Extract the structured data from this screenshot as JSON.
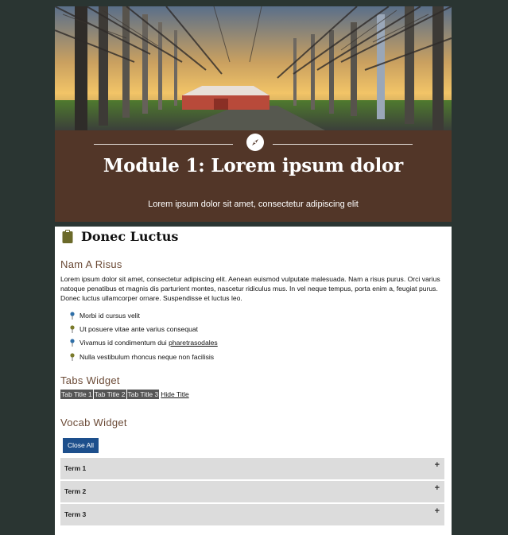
{
  "header": {
    "title": "Module 1: Lorem ipsum dolor",
    "subtitle": "Lorem ipsum dolor sit amet, consectetur adipiscing elit"
  },
  "section": {
    "title": "Donec Luctus"
  },
  "nam": {
    "heading": "Nam A Risus",
    "paragraph": "Lorem ipsum dolor sit amet, consectetur adipiscing elit. Aenean euismod vulputate malesuada. Nam a risus purus. Orci varius natoque penatibus et magnis dis parturient montes, nascetur ridiculus mus. In vel neque tempus, porta enim a, feugiat purus. Donec luctus ullamcorper ornare. Suspendisse et luctus leo.",
    "bullets": [
      {
        "text": "Morbi id cursus velit"
      },
      {
        "text": "Ut posuere vitae ante varius consequat"
      },
      {
        "text": "Vivamus id condimentum dui ",
        "link": "pharetrasodales"
      },
      {
        "text": "Nulla vestibulum rhoncus neque non facilisis"
      }
    ]
  },
  "tabs_widget": {
    "heading": "Tabs Widget",
    "tabs": [
      "Tab Title 1",
      "Tab Title 2",
      "Tab Title 3"
    ],
    "hide_label": "Hide Title"
  },
  "vocab_widget": {
    "heading": "Vocab Widget",
    "close_all": "Close All",
    "terms": [
      "Term 1",
      "Term 2",
      "Term 3"
    ],
    "expand_symbol": "+"
  },
  "colors": {
    "page_bg": "#2a3532",
    "header_bg": "#523628",
    "subheading": "#6b4a36",
    "button": "#1d4f8c",
    "tab": "#555555",
    "term_bg": "#dcdcdc",
    "pin_blue": "#2f6fa8",
    "pin_olive": "#7a7a2a"
  },
  "icons": {
    "header": "compass-icon",
    "section": "clipboard-icon",
    "bullet": "pushpin-icon",
    "term": "plus-icon"
  }
}
